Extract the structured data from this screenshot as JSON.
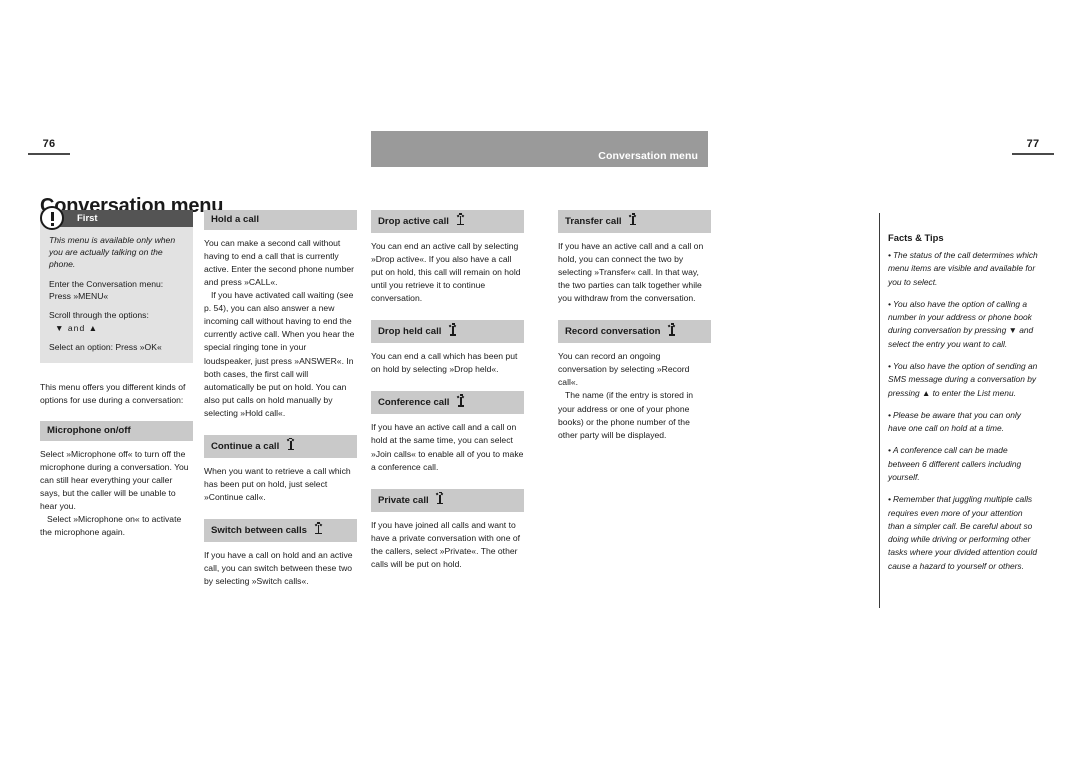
{
  "document": {
    "title": "Conversation menu",
    "running_head": "Conversation menu",
    "folio_left": "76",
    "folio_right": "77"
  },
  "first_box": {
    "label": "First",
    "icon": "exclamation-circle-icon",
    "lines": [
      "This menu is available only when you are actually talking on the phone.",
      "Enter the Conversation menu: Press »MENU«",
      "Scroll through the options:",
      "▼  and  ▲",
      "Select an option: Press »OK«"
    ]
  },
  "intro": "This menu offers you different kinds of options for use during a conversation:",
  "sections": [
    {
      "id": "microphone-on-off",
      "title": "Microphone on/off",
      "signal_icon": false,
      "paragraphs": [
        "Select »Microphone off« to turn off the microphone during a conversation. You can still hear everything your caller says, but the caller will be unable to hear you.",
        "Select »Microphone on« to activate the microphone again."
      ]
    },
    {
      "id": "hold-a-call",
      "title": "Hold a call",
      "signal_icon": false,
      "paragraphs": [
        "You can make a second call without having to  end a call that is currently active. Enter the second phone number and press »CALL«.",
        "If you have activated call waiting (see p. 54), you can also answer a new incoming call without having to end the currently active call. When you hear the special ringing tone in your loudspeaker, just press »ANSWER«. In both cases, the first call will automatically be put on hold. You can also put calls on hold manually by selecting »Hold call«."
      ]
    },
    {
      "id": "continue-a-call",
      "title": "Continue a call",
      "signal_icon": true,
      "paragraphs": [
        "When you want to retrieve a call which has been put on hold, just select »Continue call«."
      ]
    },
    {
      "id": "switch-between-calls",
      "title": "Switch between calls",
      "signal_icon": true,
      "paragraphs": [
        "If you have a call on hold and an active call, you can switch between these two by selecting »Switch calls«."
      ]
    },
    {
      "id": "drop-active-call",
      "title": "Drop active call",
      "signal_icon": true,
      "paragraphs": [
        "You can end an active call by selecting »Drop active«. If you also have a call put on hold, this call will remain on hold until you retrieve it to continue conversation."
      ]
    },
    {
      "id": "drop-held-call",
      "title": "Drop held call",
      "signal_icon": true,
      "paragraphs": [
        "You can end a call which has been put on hold by selecting  »Drop held«."
      ]
    },
    {
      "id": "conference-call",
      "title": "Conference call",
      "signal_icon": true,
      "paragraphs": [
        "If you have an active call and a call on hold at the same time, you can select »Join calls« to enable all of you to make a conference call."
      ]
    },
    {
      "id": "private-call",
      "title": "Private call",
      "signal_icon": true,
      "paragraphs": [
        "If you have joined all calls and want to have a private conversation with one of the callers, select »Private«. The other calls will be put on hold."
      ]
    },
    {
      "id": "transfer-call",
      "title": "Transfer call",
      "signal_icon": true,
      "paragraphs": [
        "If you have an active call and a call on hold, you can connect the two by selecting »Transfer« call. In that way, the two parties can talk together while you withdraw from the conversation."
      ]
    },
    {
      "id": "record-conversation",
      "title": "Record conversation",
      "signal_icon": true,
      "paragraphs": [
        "You can record an ongoing conversation by selecting »Record call«.",
        "The name (if the entry is stored in your address or one of your phone books) or the phone number of the other party will be displayed."
      ]
    }
  ],
  "notes": {
    "title": "Facts & Tips",
    "items": [
      "The status of the call determines which menu items are visible and available for you to select.",
      "You also have the option of calling a number in your address or phone book during conversation by pressing  ▼  and select the entry you want to call.",
      "You also have the option of sending an SMS message during a conversation by pressing  ▲  to enter the List menu.",
      "Please be aware that you can only have one call on hold at a time.",
      "A conference call can be made between 6 different callers including yourself.",
      "Remember that juggling multiple calls requires even more of your attention than a simpler call.  Be careful about so doing while driving or performing other tasks where your divided attention could cause a hazard to yourself or others."
    ]
  },
  "colors": {
    "header_band": "#9a9a9a",
    "section_band": "#c9c9c9",
    "callout_bar": "#545454",
    "callout_body": "#e2e2e2"
  }
}
